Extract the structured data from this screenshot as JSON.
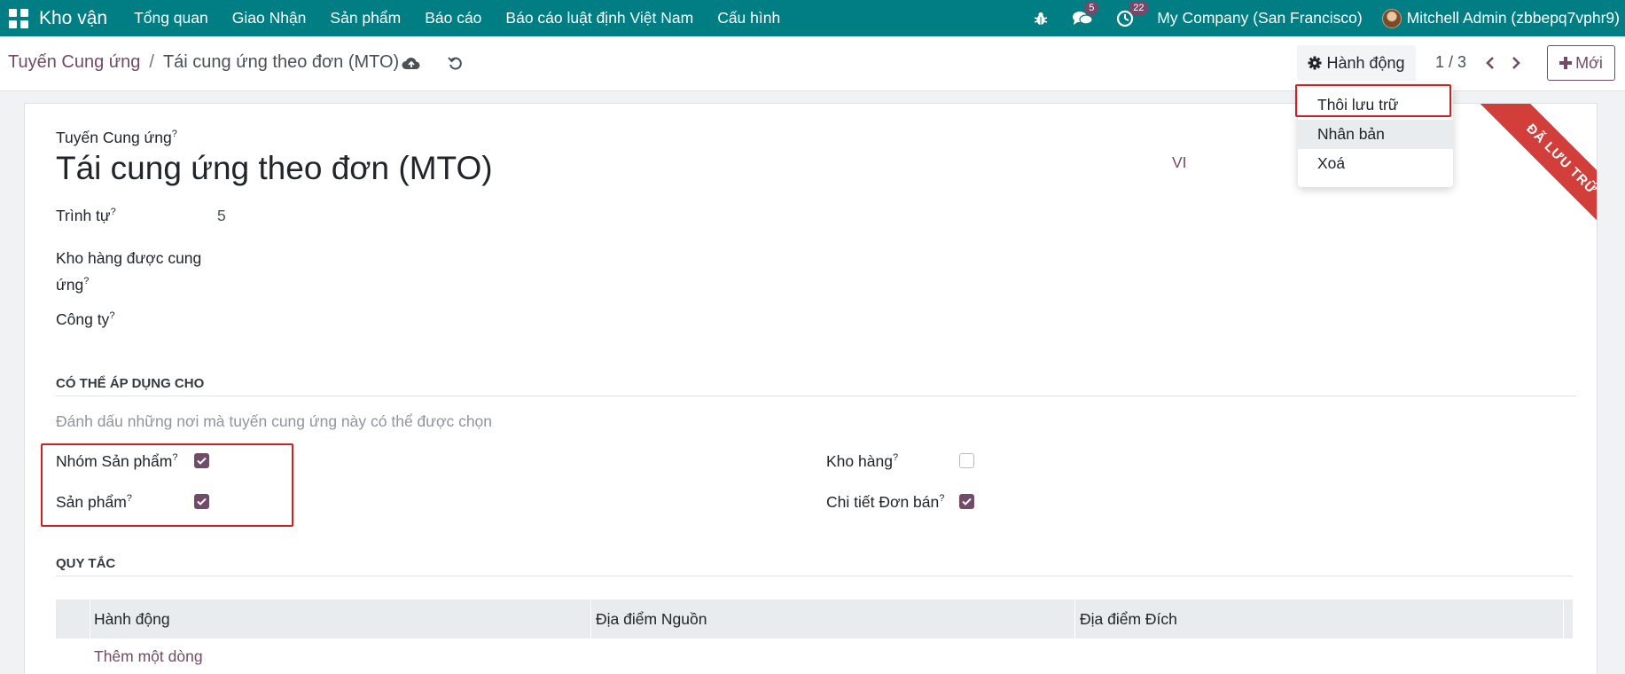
{
  "navbar": {
    "brand": "Kho vận",
    "menu": [
      "Tổng quan",
      "Giao Nhận",
      "Sản phẩm",
      "Báo cáo",
      "Báo cáo luật định Việt Nam",
      "Cấu hình"
    ],
    "messages_count": "5",
    "activities_count": "22",
    "company": "My Company (San Francisco)",
    "user": "Mitchell Admin (zbbepq7vphr9)"
  },
  "breadcrumb": {
    "parent": "Tuyến Cung ứng",
    "separator": "/",
    "current": "Tái cung ứng theo đơn (MTO)"
  },
  "control": {
    "action_label": "Hành động",
    "pager": "1 / 3",
    "new_label": "Mới"
  },
  "dropdown": {
    "items": [
      "Thôi lưu trữ",
      "Nhân bản",
      "Xoá"
    ]
  },
  "ribbon": "ĐÃ LƯU TRỮ",
  "form": {
    "route_label": "Tuyến Cung ứng",
    "route_name": "Tái cung ứng theo đơn (MTO)",
    "lang": "VI",
    "sequence_label": "Trình tự",
    "sequence_value": "5",
    "warehouse_supplied_label_1": "Kho hàng được cung",
    "warehouse_supplied_label_2": "ứng",
    "company_label": "Công ty",
    "help_mark": "?"
  },
  "applicable": {
    "heading": "CÓ THỂ ÁP DỤNG CHO",
    "description": "Đánh dấu những nơi mà tuyến cung ứng này có thể được chọn",
    "product_category_label": "Nhóm Sản phẩm",
    "product_category_checked": true,
    "product_label": "Sản phẩm",
    "product_checked": true,
    "warehouse_label": "Kho hàng",
    "warehouse_checked": false,
    "sale_line_label": "Chi tiết Đơn bán",
    "sale_line_checked": true
  },
  "rules": {
    "heading": "QUY TẮC",
    "columns": [
      "Hành động",
      "Địa điểm Nguồn",
      "Địa điểm Đích"
    ],
    "add_line": "Thêm một dòng"
  },
  "colors": {
    "navbar": "#017e84",
    "accent": "#714b67",
    "ribbon": "#d23f3a",
    "highlight": "#d21f1f"
  }
}
